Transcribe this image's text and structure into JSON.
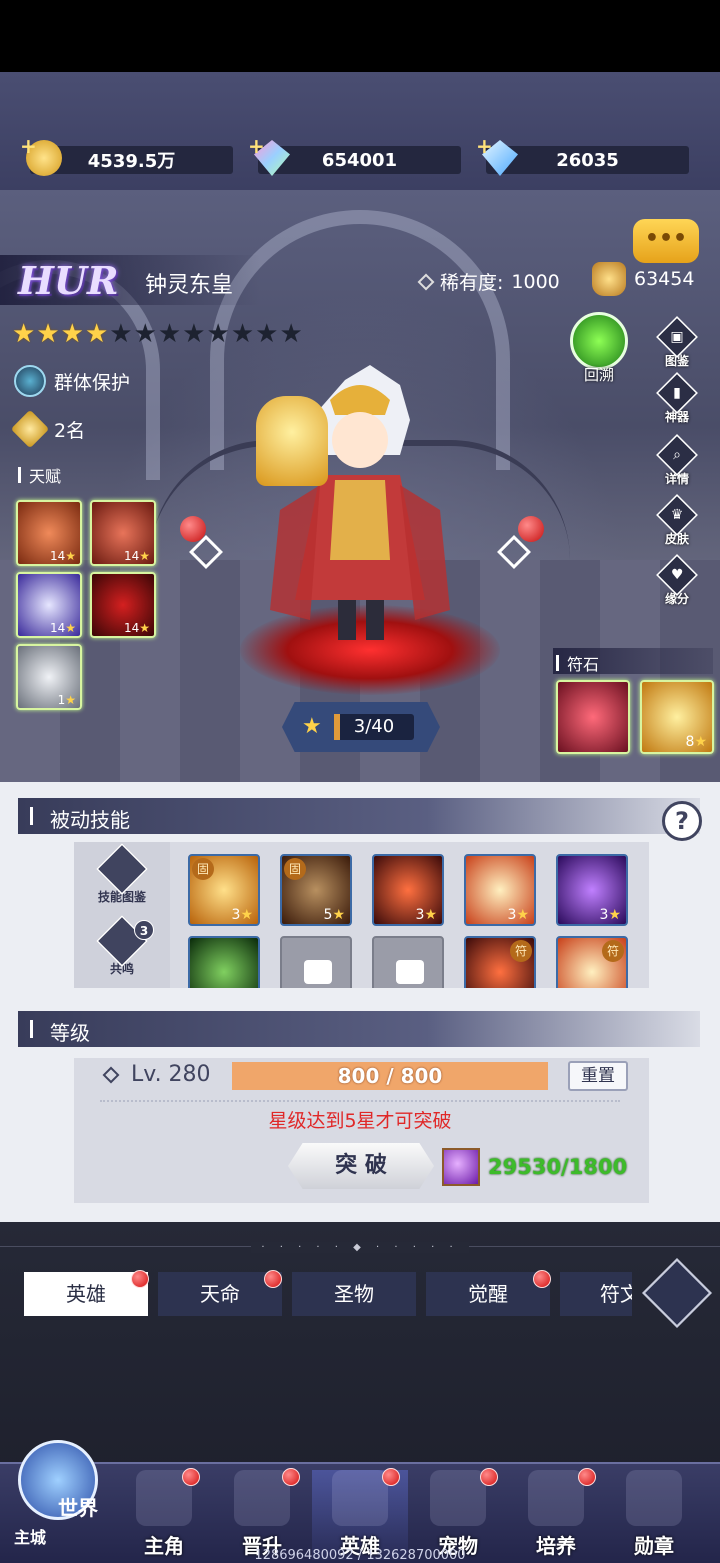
{
  "resources": [
    {
      "icon": "gold-coin-icon",
      "value": "4539.5万"
    },
    {
      "icon": "rainbow-crystal-icon",
      "value": "654001"
    },
    {
      "icon": "blue-diamond-icon",
      "value": "26035"
    }
  ],
  "hero": {
    "grade": "HUR",
    "name": "钟灵东皇",
    "rarity_label": "稀有度:",
    "rarity_value": "1000",
    "power": "63454",
    "stars_filled": 4,
    "stars_total": 12,
    "role": "群体保护",
    "rank": "2名"
  },
  "chat_label": "•••",
  "talent": {
    "title": "天赋",
    "items": [
      {
        "level": "14",
        "color": "#c4461e"
      },
      {
        "level": "14",
        "color": "#b8331b"
      },
      {
        "level": "14",
        "color": "#6a5cd6"
      },
      {
        "level": "14",
        "color": "#8a1515"
      },
      {
        "level": "1",
        "color": "#b9c0c8"
      }
    ]
  },
  "side_buttons": [
    {
      "icon": "codex-icon",
      "label": "图鉴"
    },
    {
      "icon": "artifact-icon",
      "label": "神器"
    },
    {
      "icon": "details-icon",
      "label": "详情"
    },
    {
      "icon": "skin-icon",
      "label": "皮肤"
    },
    {
      "icon": "fate-icon",
      "label": "缘分"
    }
  ],
  "huisu_label": "回溯",
  "rune": {
    "title": "符石",
    "items": [
      {
        "level": "",
        "color": "#c8324a"
      },
      {
        "level": "8",
        "color": "#e6a21a"
      }
    ]
  },
  "star_progress": {
    "current": 3,
    "max": 40,
    "text": "3/40",
    "fraction": 0.075
  },
  "passive": {
    "title": "被动技能",
    "help": "?",
    "codex_label": "技能图鉴",
    "resonance_label": "共鸣",
    "resonance_badge": "3",
    "skills_row1": [
      {
        "level": "3",
        "badge": "固",
        "color": "#d88a1a"
      },
      {
        "level": "5",
        "badge": "固",
        "color": "#8a4a2a"
      },
      {
        "level": "3",
        "badge": "",
        "color": "#b8321a"
      },
      {
        "level": "3",
        "badge": "",
        "color": "#d86a2a"
      },
      {
        "level": "3",
        "badge": "",
        "color": "#6a2aa8"
      }
    ],
    "skills_row2": [
      {
        "locked": false,
        "badge": "",
        "color": "#3a8a2a"
      },
      {
        "locked": true
      },
      {
        "locked": true
      },
      {
        "locked": false,
        "badge": "符",
        "color": "#b8321a"
      },
      {
        "locked": false,
        "badge": "符",
        "color": "#d86a2a"
      }
    ]
  },
  "level": {
    "title": "等级",
    "level_text": "Lv. 280",
    "xp_text": "800 / 800",
    "xp_fraction": 1.0,
    "reset_label": "重置",
    "warning": "星级达到5星才可突破",
    "break_label": "突 破",
    "cost_text": "29530/1800"
  },
  "divider": "· · · · · ◆ · · · · ·",
  "tabs": [
    {
      "label": "英雄",
      "active": true,
      "dot": true
    },
    {
      "label": "天命",
      "active": false,
      "dot": true
    },
    {
      "label": "圣物",
      "active": false,
      "dot": false
    },
    {
      "label": "觉醒",
      "active": false,
      "dot": true
    },
    {
      "label": "符文",
      "active": false,
      "dot": false
    }
  ],
  "nav": {
    "world_label": "世界",
    "city_label": "主城",
    "items": [
      {
        "label": "主角",
        "icon": "hero-main-icon",
        "active": false,
        "dot": true
      },
      {
        "label": "晋升",
        "icon": "promote-icon",
        "active": false,
        "dot": true
      },
      {
        "label": "英雄",
        "icon": "helmet-icon",
        "active": true,
        "dot": true
      },
      {
        "label": "宠物",
        "icon": "pet-icon",
        "active": false,
        "dot": true
      },
      {
        "label": "培养",
        "icon": "train-icon",
        "active": false,
        "dot": true
      },
      {
        "label": "勋章",
        "icon": "medal-icon",
        "active": false,
        "dot": false
      }
    ]
  },
  "uid": "128696480092 / 132628700000"
}
